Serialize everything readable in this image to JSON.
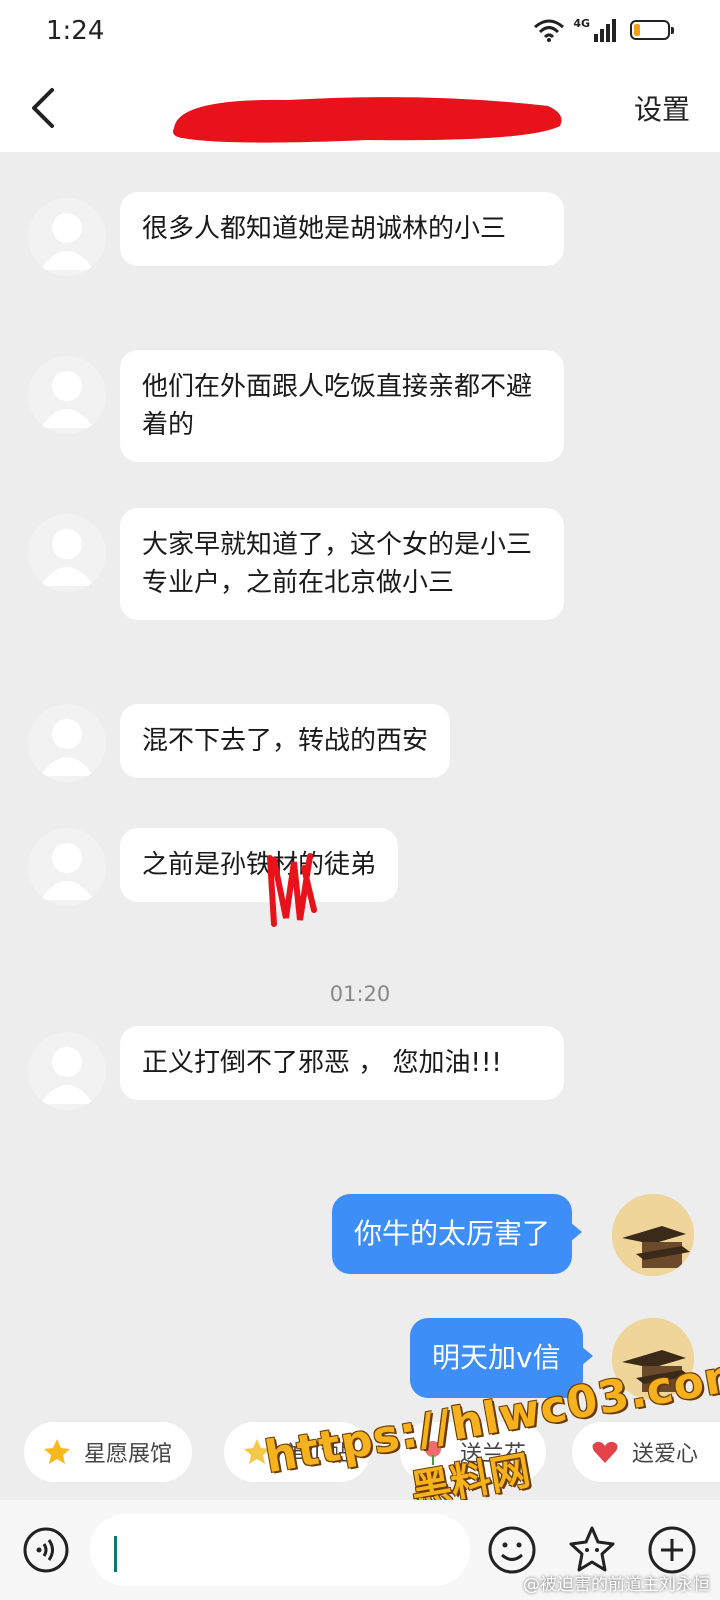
{
  "status_bar": {
    "time": "1:24",
    "network": "4G",
    "battery_level": 0.2,
    "battery_color": "#f3a01b"
  },
  "header": {
    "back_icon": "chevron-left-icon",
    "settings_label": "设置",
    "redaction_color": "#e8121b"
  },
  "messages": [
    {
      "sender": "other",
      "text": "很多人都知道她是胡诚林的小三"
    },
    {
      "sender": "other",
      "text": "他们在外面跟人吃饭直接亲都不避着的"
    },
    {
      "sender": "other",
      "text": "大家早就知道了，这个女的是小三专业户，之前在北京做小三"
    },
    {
      "sender": "other",
      "text": "混不下去了，转战的西安"
    },
    {
      "sender": "other",
      "text": "之前是孙铁材的徒弟"
    },
    {
      "sender": "other",
      "text": "正义打倒不了邪恶 ， 您加油!!!"
    },
    {
      "sender": "me",
      "text": "你牛的太厉害了"
    },
    {
      "sender": "me",
      "text": "明天加v信"
    }
  ],
  "timestamp": "01:20",
  "quick_actions": [
    {
      "label": "星愿展馆",
      "icon": "star-icon"
    },
    {
      "label": "单小帖",
      "icon": "sticker-icon"
    },
    {
      "label": "送兰花",
      "icon": "flower-icon"
    },
    {
      "label": "送爱心",
      "icon": "heart-icon"
    }
  ],
  "watermark": {
    "url": "https://hlwc03.com",
    "name": "黑料网",
    "credit": "@被迫害的前道主刘永恒"
  },
  "input_bar": {
    "icons": [
      "voice-icon",
      "emoji-icon",
      "sticker-star-icon",
      "plus-icon"
    ]
  },
  "colors": {
    "my_bubble": "#3e8ef7",
    "other_bubble": "#ffffff",
    "chat_background": "#ededed"
  }
}
